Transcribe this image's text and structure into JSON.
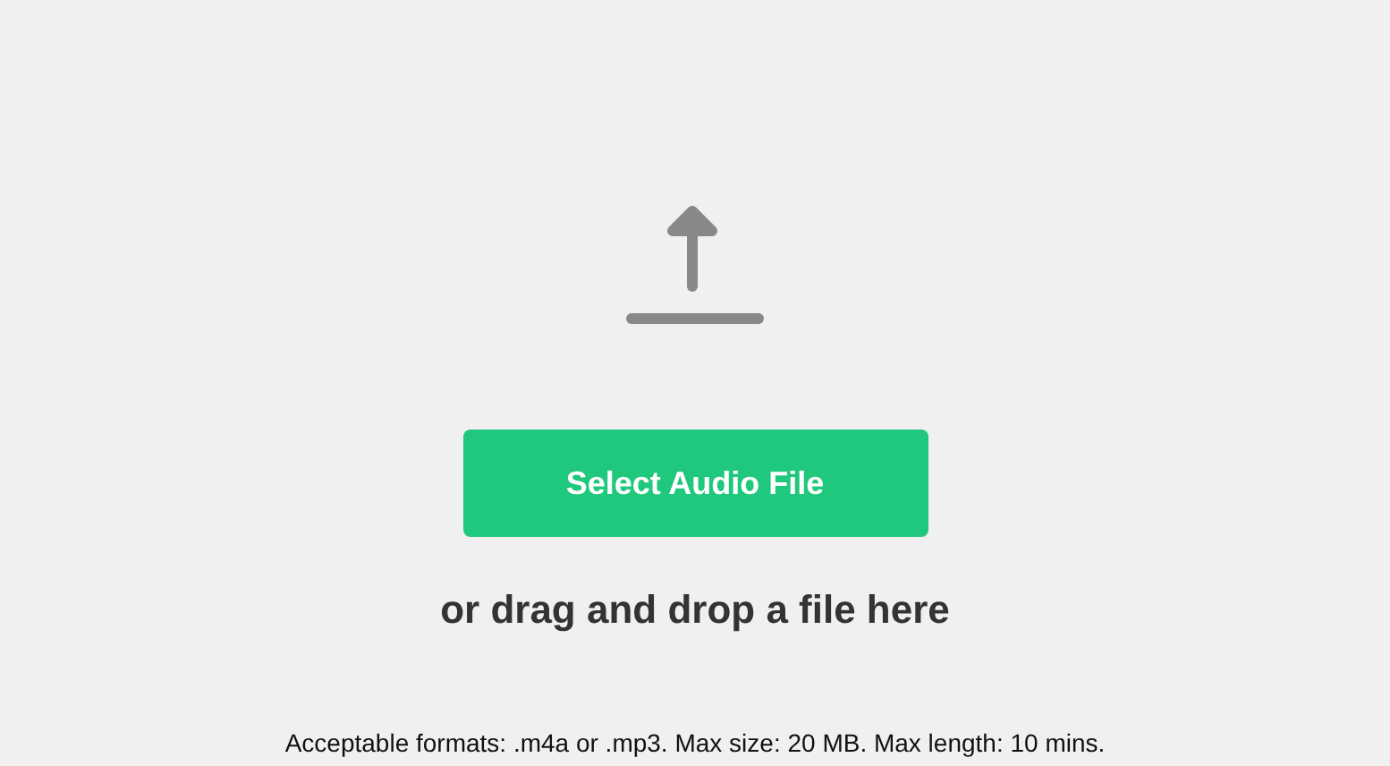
{
  "upload": {
    "button": "Select Audio File",
    "drop_hint": "or drag and drop a file here",
    "formats_note": "Acceptable formats: .m4a or .mp3. Max size: 20 MB. Max length: 10 mins."
  }
}
